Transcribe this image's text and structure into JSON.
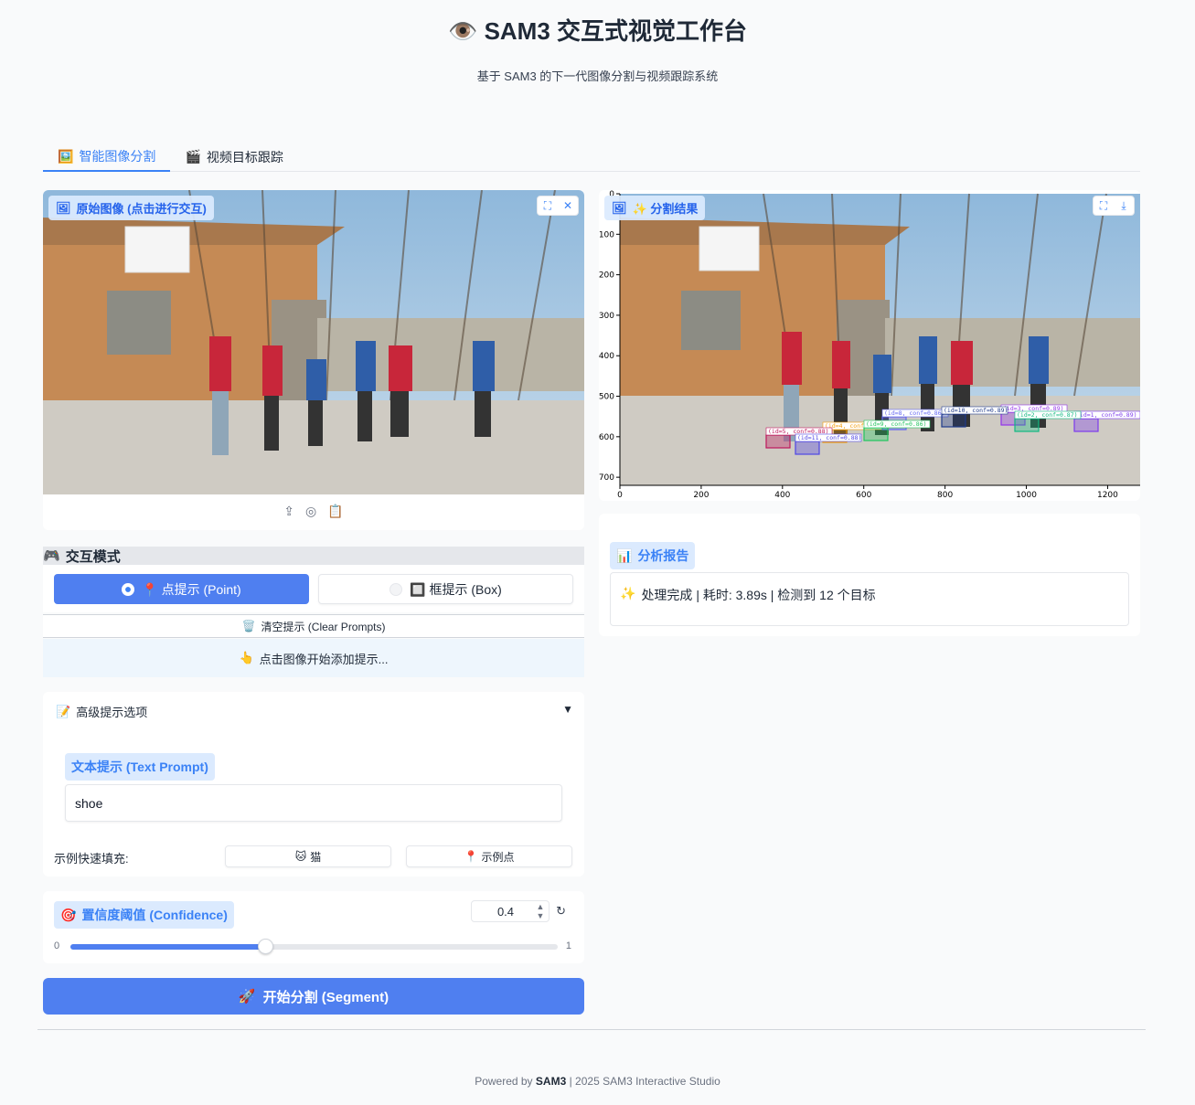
{
  "header": {
    "title": "👁️ SAM3 交互式视觉工作台",
    "subtitle": "基于 SAM3 的下一代图像分割与视频跟踪系统"
  },
  "tabs": [
    {
      "icon": "🖼️",
      "label": "智能图像分割",
      "active": true
    },
    {
      "icon": "🎬",
      "label": "视频目标跟踪",
      "active": false
    }
  ],
  "input_image": {
    "label": "原始图像 (点击进行交互)"
  },
  "result_image": {
    "label": "✨ 分割结果",
    "axes": {
      "x_ticks": [
        "0",
        "200",
        "400",
        "600",
        "800",
        "1000",
        "1200"
      ],
      "y_ticks": [
        "0",
        "100",
        "200",
        "300",
        "400",
        "500",
        "600",
        "700"
      ]
    },
    "detections": [
      "id=1, conf=0.89",
      "id=3, conf=0.89",
      "id=4, conf",
      "id=5, conf=0.88",
      "id=8, conf=0.86",
      "id=9, conf=0.86",
      "id=10, conf=0.89",
      "id=11, conf=0.88",
      "id=2, conf=0.87"
    ]
  },
  "interaction": {
    "section_title": "交互模式",
    "point_mode": "📍 点提示 (Point)",
    "box_mode": "🔲 框提示 (Box)",
    "clear_label": "清空提示 (Clear Prompts)",
    "hint": "点击图像开始添加提示..."
  },
  "advanced": {
    "title": "高级提示选项",
    "text_prompt_label": "文本提示 (Text Prompt)",
    "text_prompt_value": "shoe",
    "examples_label": "示例快速填充:",
    "example_cat": "猫",
    "example_point": "示例点"
  },
  "confidence": {
    "label": "置信度阈值 (Confidence)",
    "value": "0.4",
    "min": "0",
    "max": "1",
    "fraction": 0.4
  },
  "segment_button": "开始分割 (Segment)",
  "report": {
    "title": "分析报告",
    "text": "处理完成 | 耗时: 3.89s | 检测到 12 个目标"
  },
  "footer": {
    "prefix": "Powered by",
    "brand": "SAM3",
    "suffix": "| 2025 SAM3 Interactive Studio"
  },
  "colors": {
    "accent": "#4f7ff0",
    "chip_bg": "#dbeafe"
  }
}
